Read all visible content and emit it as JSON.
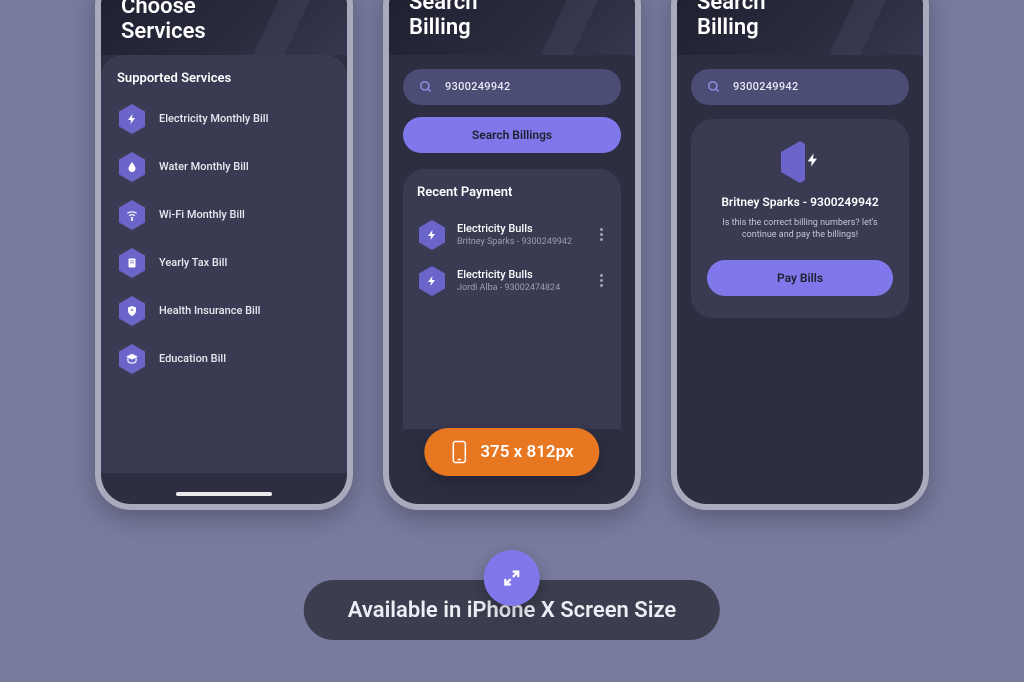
{
  "colors": {
    "accent": "#8078ea",
    "pill": "#e87722",
    "panel": "#3a3b52",
    "bg": "#787a9e"
  },
  "screens": {
    "services": {
      "title_l1": "Choose",
      "title_l2": "Services",
      "panel_title": "Supported Services",
      "items": [
        {
          "icon": "bolt",
          "label": "Electricity Monthly Bill"
        },
        {
          "icon": "drop",
          "label": "Water Monthly Bill"
        },
        {
          "icon": "wifi",
          "label": "Wi-Fi Monthly Bill"
        },
        {
          "icon": "doc",
          "label": "Yearly Tax Bill"
        },
        {
          "icon": "shield",
          "label": "Health Insurance Bill"
        },
        {
          "icon": "grad",
          "label": "Education Bill"
        }
      ]
    },
    "search": {
      "title_l1": "Search",
      "title_l2": "Billing",
      "value": "9300249942",
      "button": "Search Billings",
      "recent_title": "Recent Payment",
      "recent": [
        {
          "title": "Electricity Bulls",
          "sub": "Britney Sparks - 9300249942"
        },
        {
          "title": "Electricity Bulls",
          "sub": "Jordi Alba - 93002474824"
        }
      ]
    },
    "result": {
      "title_l1": "Search",
      "title_l2": "Billing",
      "value": "9300249942",
      "name": "Britney Sparks - 9300249942",
      "question": "Is this the correct billing numbers? let's continue and pay the billings!",
      "button": "Pay Bills"
    }
  },
  "size_pill": "375 x 812px",
  "banner": "Available in iPhone X Screen Size"
}
